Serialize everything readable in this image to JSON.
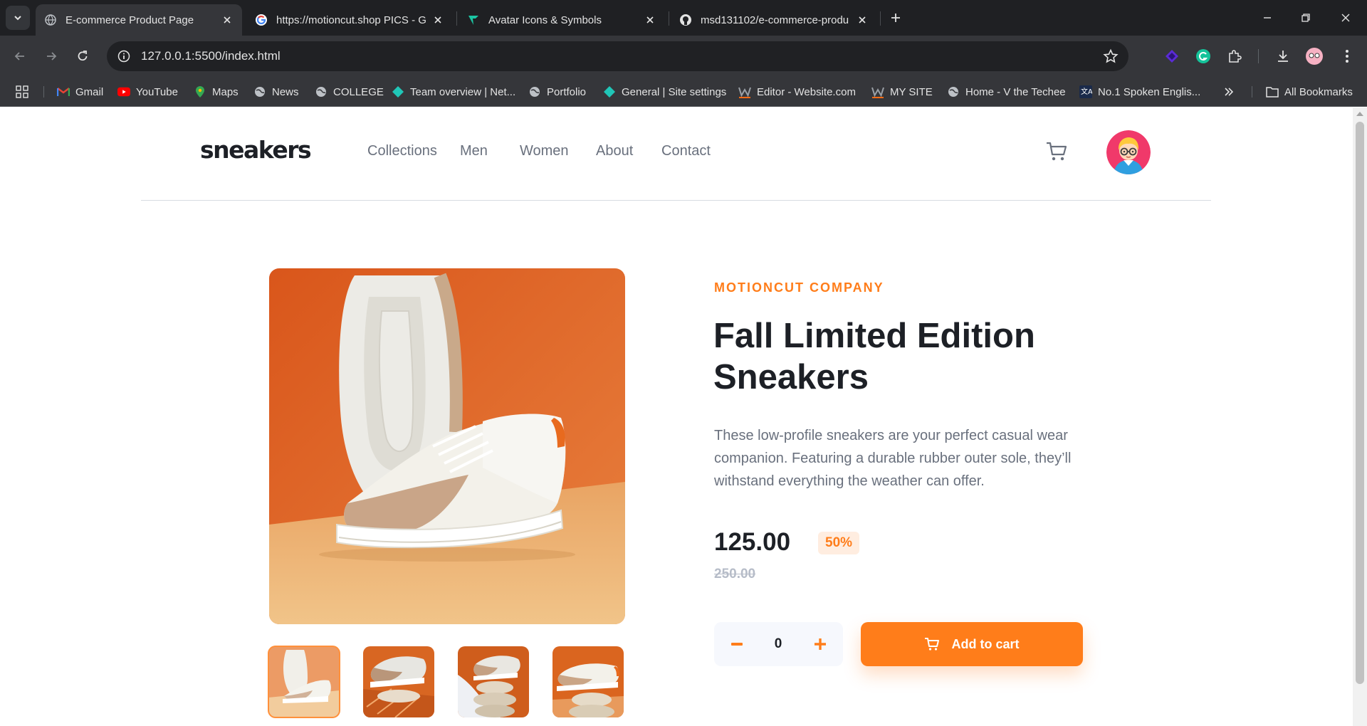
{
  "browser": {
    "tabs": [
      {
        "title": "E-commerce Product Page",
        "icon": "globe-icon",
        "active": true
      },
      {
        "title": "https://motioncut.shop PICS - G",
        "icon": "google-icon",
        "active": false
      },
      {
        "title": "Avatar Icons & Symbols",
        "icon": "flaticon-icon",
        "active": false
      },
      {
        "title": "msd131102/e-commerce-produ",
        "icon": "github-icon",
        "active": false
      }
    ],
    "url": "127.0.0.1:5500/index.html",
    "bookmarks": [
      {
        "label": "Gmail",
        "icon": "gmail-icon"
      },
      {
        "label": "YouTube",
        "icon": "youtube-icon"
      },
      {
        "label": "Maps",
        "icon": "maps-icon"
      },
      {
        "label": "News",
        "icon": "globe-icon"
      },
      {
        "label": "COLLEGE",
        "icon": "globe-icon"
      },
      {
        "label": "Team overview | Net...",
        "icon": "netlify-icon"
      },
      {
        "label": "Portfolio",
        "icon": "globe-icon"
      },
      {
        "label": "General | Site settings",
        "icon": "netlify-icon"
      },
      {
        "label": "Editor - Website.com",
        "icon": "website-icon"
      },
      {
        "label": "MY SITE",
        "icon": "website-icon"
      },
      {
        "label": "Home - V the Techee",
        "icon": "globe-icon"
      },
      {
        "label": "No.1 Spoken Englis...",
        "icon": "translate-icon"
      }
    ],
    "all_bookmarks": "All Bookmarks"
  },
  "site": {
    "logo": "sneakers",
    "nav": [
      "Collections",
      "Men",
      "Women",
      "About",
      "Contact"
    ]
  },
  "product": {
    "company": "MOTIONCUT COMPANY",
    "title": "Fall Limited Edition Sneakers",
    "description": "These low-profile sneakers are your perfect casual wear companion. Featuring a durable rubber outer sole, they’ll withstand everything the weather can offer.",
    "price": "125.00",
    "discount": "50%",
    "old_price": "250.00",
    "quantity": "0",
    "add_to_cart": "Add to cart"
  },
  "colors": {
    "accent": "#ff7d1a",
    "accent_pale": "#ffede0",
    "text_dark": "#1d2026",
    "text_muted": "#69707d"
  }
}
